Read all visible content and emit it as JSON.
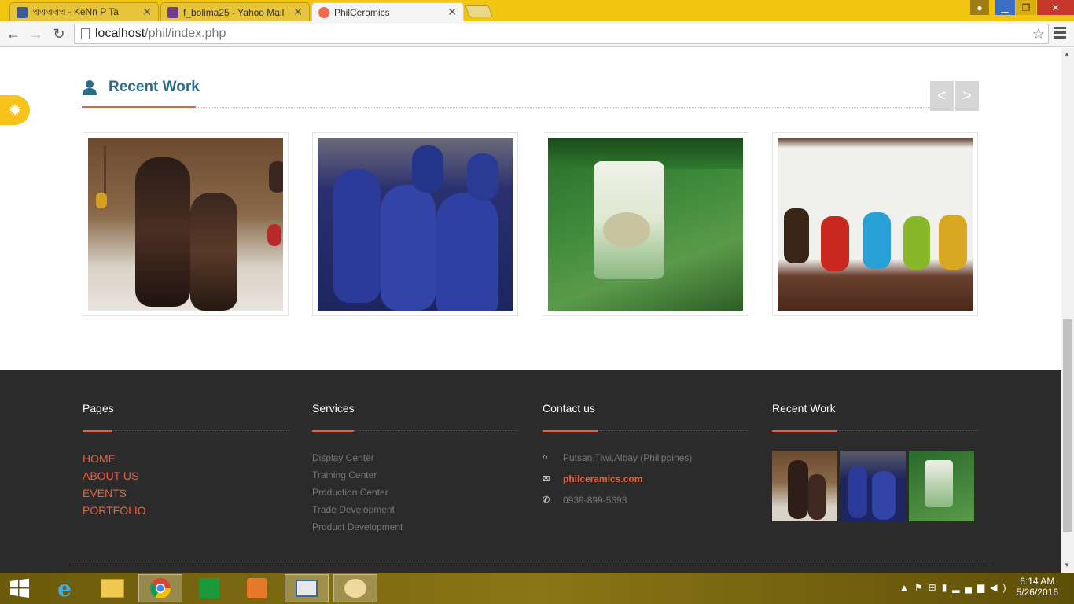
{
  "browser": {
    "tabs": [
      {
        "label": "ଏଏଏଏଏ‍ - KeNn P Ta",
        "favicon": "facebook-icon",
        "active": false
      },
      {
        "label": "f_bolima25 - Yahoo Mail",
        "favicon": "mail-icon",
        "active": false
      },
      {
        "label": "PhilCeramics",
        "favicon": "site-icon",
        "active": true
      }
    ],
    "url_host": "localhost",
    "url_path": "/phil/index.php"
  },
  "recent_work": {
    "title": "Recent Work",
    "prev_label": "<",
    "next_label": ">"
  },
  "footer": {
    "pages": {
      "title": "Pages",
      "items": [
        "HOME",
        "ABOUT US",
        "EVENTS",
        "PORTFOLIO"
      ]
    },
    "services": {
      "title": "Services",
      "items": [
        "Display Center",
        "Training Center",
        "Production Center",
        "Trade Development",
        "Product Development"
      ]
    },
    "contact": {
      "title": "Contact us",
      "address": "Putsan,Tiwi,Albay (Philippines)",
      "email": "philceramics.com",
      "phone": "0939-899-5693"
    },
    "recent_work": {
      "title": "Recent Work"
    }
  },
  "taskbar": {
    "time": "6:14 AM",
    "date": "5/26/2016"
  },
  "colors": {
    "accent": "#e8603c",
    "heading": "#2b6b8a",
    "footer_bg": "#2b2b2b",
    "tabbar": "#f2c511"
  }
}
